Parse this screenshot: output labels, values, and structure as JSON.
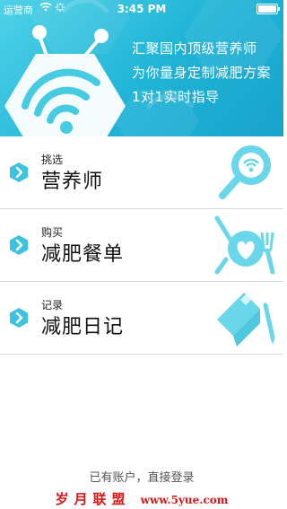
{
  "status_bar": {
    "carrier": "运营商",
    "time": "3:45 PM"
  },
  "hero": {
    "slogan_lines": [
      "汇聚国内顶级营养师",
      "为你量身定制减肥方案",
      "1对1实时指导"
    ],
    "background_color": "#1fb3d6"
  },
  "menu": {
    "items": [
      {
        "sub_label": "挑选",
        "title": "营养师",
        "icon": "nutritionist-search-icon"
      },
      {
        "sub_label": "购买",
        "title": "减肥餐单",
        "icon": "meal-plan-icon"
      },
      {
        "sub_label": "记录",
        "title": "减肥日记",
        "icon": "diary-icon"
      }
    ],
    "accent_color": "#3cc3e0"
  },
  "footer": {
    "login_text": "已有账户，直接登录",
    "watermark_cn": "岁月联盟",
    "watermark_url": "www.5yue.com"
  }
}
